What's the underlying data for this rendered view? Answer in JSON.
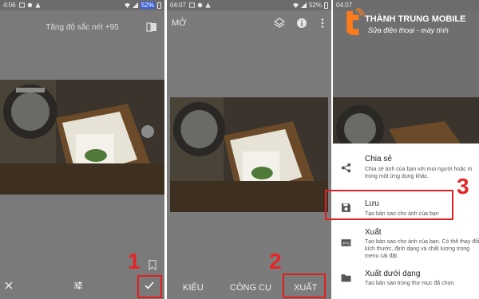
{
  "panel1": {
    "status": {
      "time": "4:06",
      "battery": "52%"
    },
    "top_label": "Tăng độ sắc nét +95",
    "step": "1"
  },
  "panel2": {
    "status": {
      "time": "04:07",
      "battery": "52%"
    },
    "title": "MỞ",
    "bottom_tabs": [
      "KIỂU",
      "CÔNG CỤ",
      "XUẤT"
    ],
    "step": "2"
  },
  "panel3": {
    "status": {
      "time": "04:07"
    },
    "logo": {
      "title": "THÀNH TRUNG MOBILE",
      "subtitle": "Sửa điện thoại - máy tính"
    },
    "step": "3",
    "menu": [
      {
        "title": "Chia sẻ",
        "desc": "Chia sẻ ảnh của bạn với mọi người hoặc m trong một ứng dụng khác.",
        "icon": "share-icon"
      },
      {
        "title": "Lưu",
        "desc": "Tạo bản sao cho ảnh của bạn",
        "icon": "save-icon"
      },
      {
        "title": "Xuất",
        "desc": "Tạo bản sao cho ảnh của bạn. Có thể thay đổi kích thước, định dạng và chất lượng trong menu cài đặt.",
        "icon": "jpg-icon"
      },
      {
        "title": "Xuất dưới dạng",
        "desc": "Tạo bản sao trong thư mục đã chọn.",
        "icon": "folder-icon"
      }
    ]
  },
  "colors": {
    "highlight": "#e02020",
    "overlay": "#777777"
  }
}
